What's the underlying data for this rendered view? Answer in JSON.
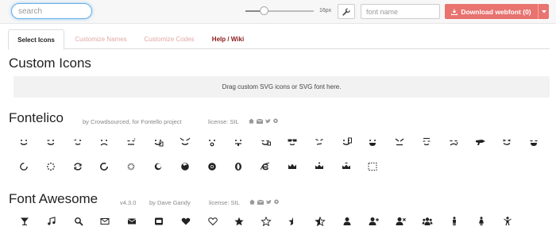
{
  "toolbar": {
    "search_placeholder": "search",
    "slider_value": 0.27,
    "size_label": "16px",
    "fontname_placeholder": "font name",
    "download_label": "Download webfont (0)"
  },
  "tabs": [
    {
      "label": "Select Icons"
    },
    {
      "label": "Customize Names"
    },
    {
      "label": "Customize Codes"
    },
    {
      "label": "Help / Wiki"
    }
  ],
  "custom": {
    "title": "Custom Icons",
    "dropzone": "Drag custom SVG icons or SVG font here."
  },
  "fontelico": {
    "title": "Fontelico",
    "author": "by Crowdsourced, for Fontello project",
    "license": "license: SIL",
    "icons": [
      "emo-happy",
      "emo-wink",
      "emo-wink2",
      "emo-unhappy",
      "emo-sleep",
      "emo-thumbsup",
      "emo-devil",
      "emo-surprised",
      "emo-tongue",
      "emo-coffee",
      "emo-sunglasses",
      "emo-displeased",
      "emo-beer",
      "emo-grin",
      "emo-angry",
      "emo-saint",
      "emo-cry",
      "emo-shoot",
      "emo-squint",
      "emo-laugh",
      "spin1",
      "spin2",
      "spin3",
      "spin4",
      "spin5",
      "spin6",
      "firefox",
      "chrome",
      "opera",
      "ie",
      "crown",
      "crown-plus",
      "crown-minus",
      "marquee"
    ]
  },
  "fontawesome": {
    "title": "Font Awesome",
    "version": "v4.3.0",
    "author": "by Dave Gandy",
    "license": "license: SIL",
    "icons": [
      "glass",
      "music",
      "search",
      "mail",
      "mail-alt",
      "mail-squared",
      "heart",
      "heart-empty",
      "star",
      "star-empty",
      "star-half",
      "star-half-alt",
      "user",
      "user-plus",
      "user-times",
      "users",
      "male",
      "female",
      "child"
    ]
  },
  "colors": {
    "accent": "#e8736f",
    "focus": "#66afe9",
    "help_tab": "#8b1a1a",
    "inactive_tab": "#e0a8a5"
  }
}
